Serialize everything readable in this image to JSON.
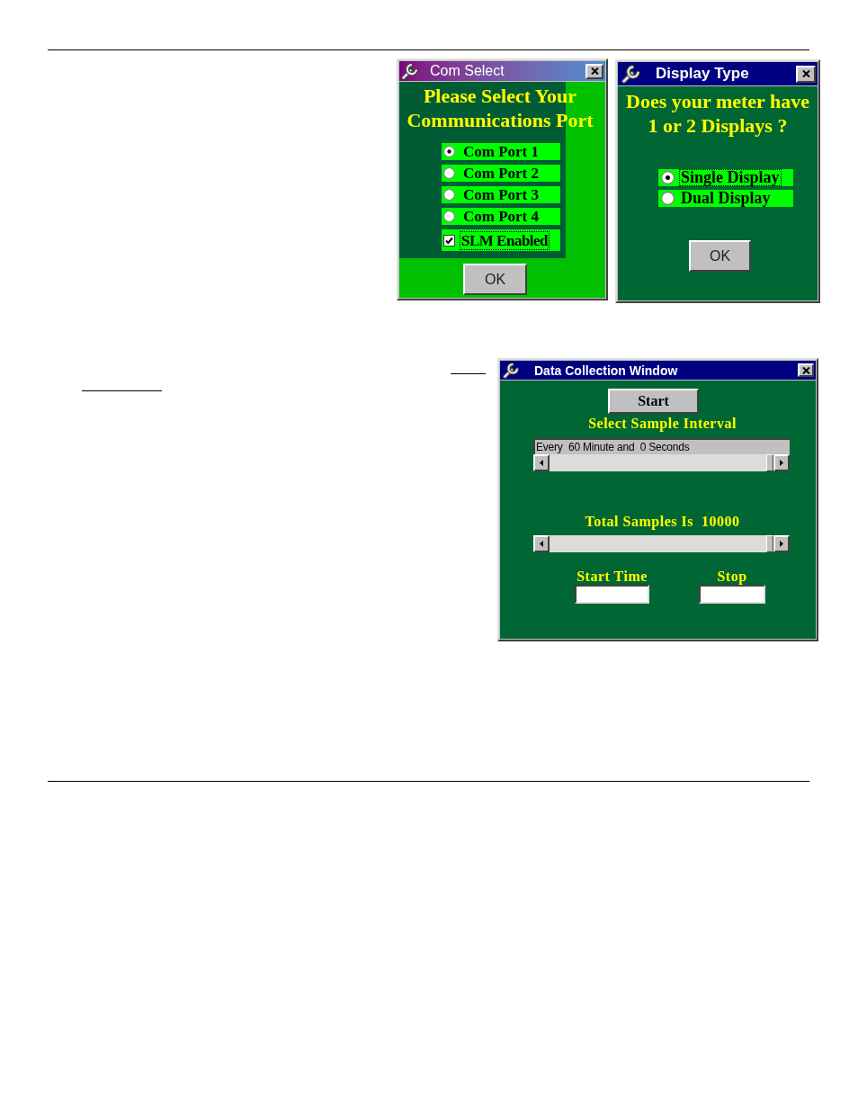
{
  "com_select": {
    "title": "Com Select",
    "heading": "Please Select Your Communications Port",
    "ports": [
      {
        "label": "Com Port 1",
        "selected": true
      },
      {
        "label": "Com Port 2",
        "selected": false
      },
      {
        "label": "Com Port 3",
        "selected": false
      },
      {
        "label": "Com Port 4",
        "selected": false
      }
    ],
    "slm_enabled": {
      "label": "SLM Enabled",
      "checked": true,
      "focused": true
    },
    "button": "OK"
  },
  "display_type": {
    "title": "Display Type",
    "question": "Does your meter have 1 or 2 Displays ?",
    "options": [
      {
        "label": "Single Display",
        "selected": true,
        "focused": true
      },
      {
        "label": "Dual Display",
        "selected": false,
        "focused": false
      }
    ],
    "button": "OK"
  },
  "data_collection": {
    "title": "Data Collection Window",
    "start_button": "Start",
    "interval_label": "Select Sample Interval",
    "interval_value": "Every  60 Minute and  0 Seconds",
    "interval_slider": {
      "level": 1
    },
    "total_label": "Total Samples Is  10000",
    "total_slider": {
      "level": 1
    },
    "fields": [
      {
        "label": "Start Time"
      },
      {
        "label": "Stop"
      }
    ]
  }
}
